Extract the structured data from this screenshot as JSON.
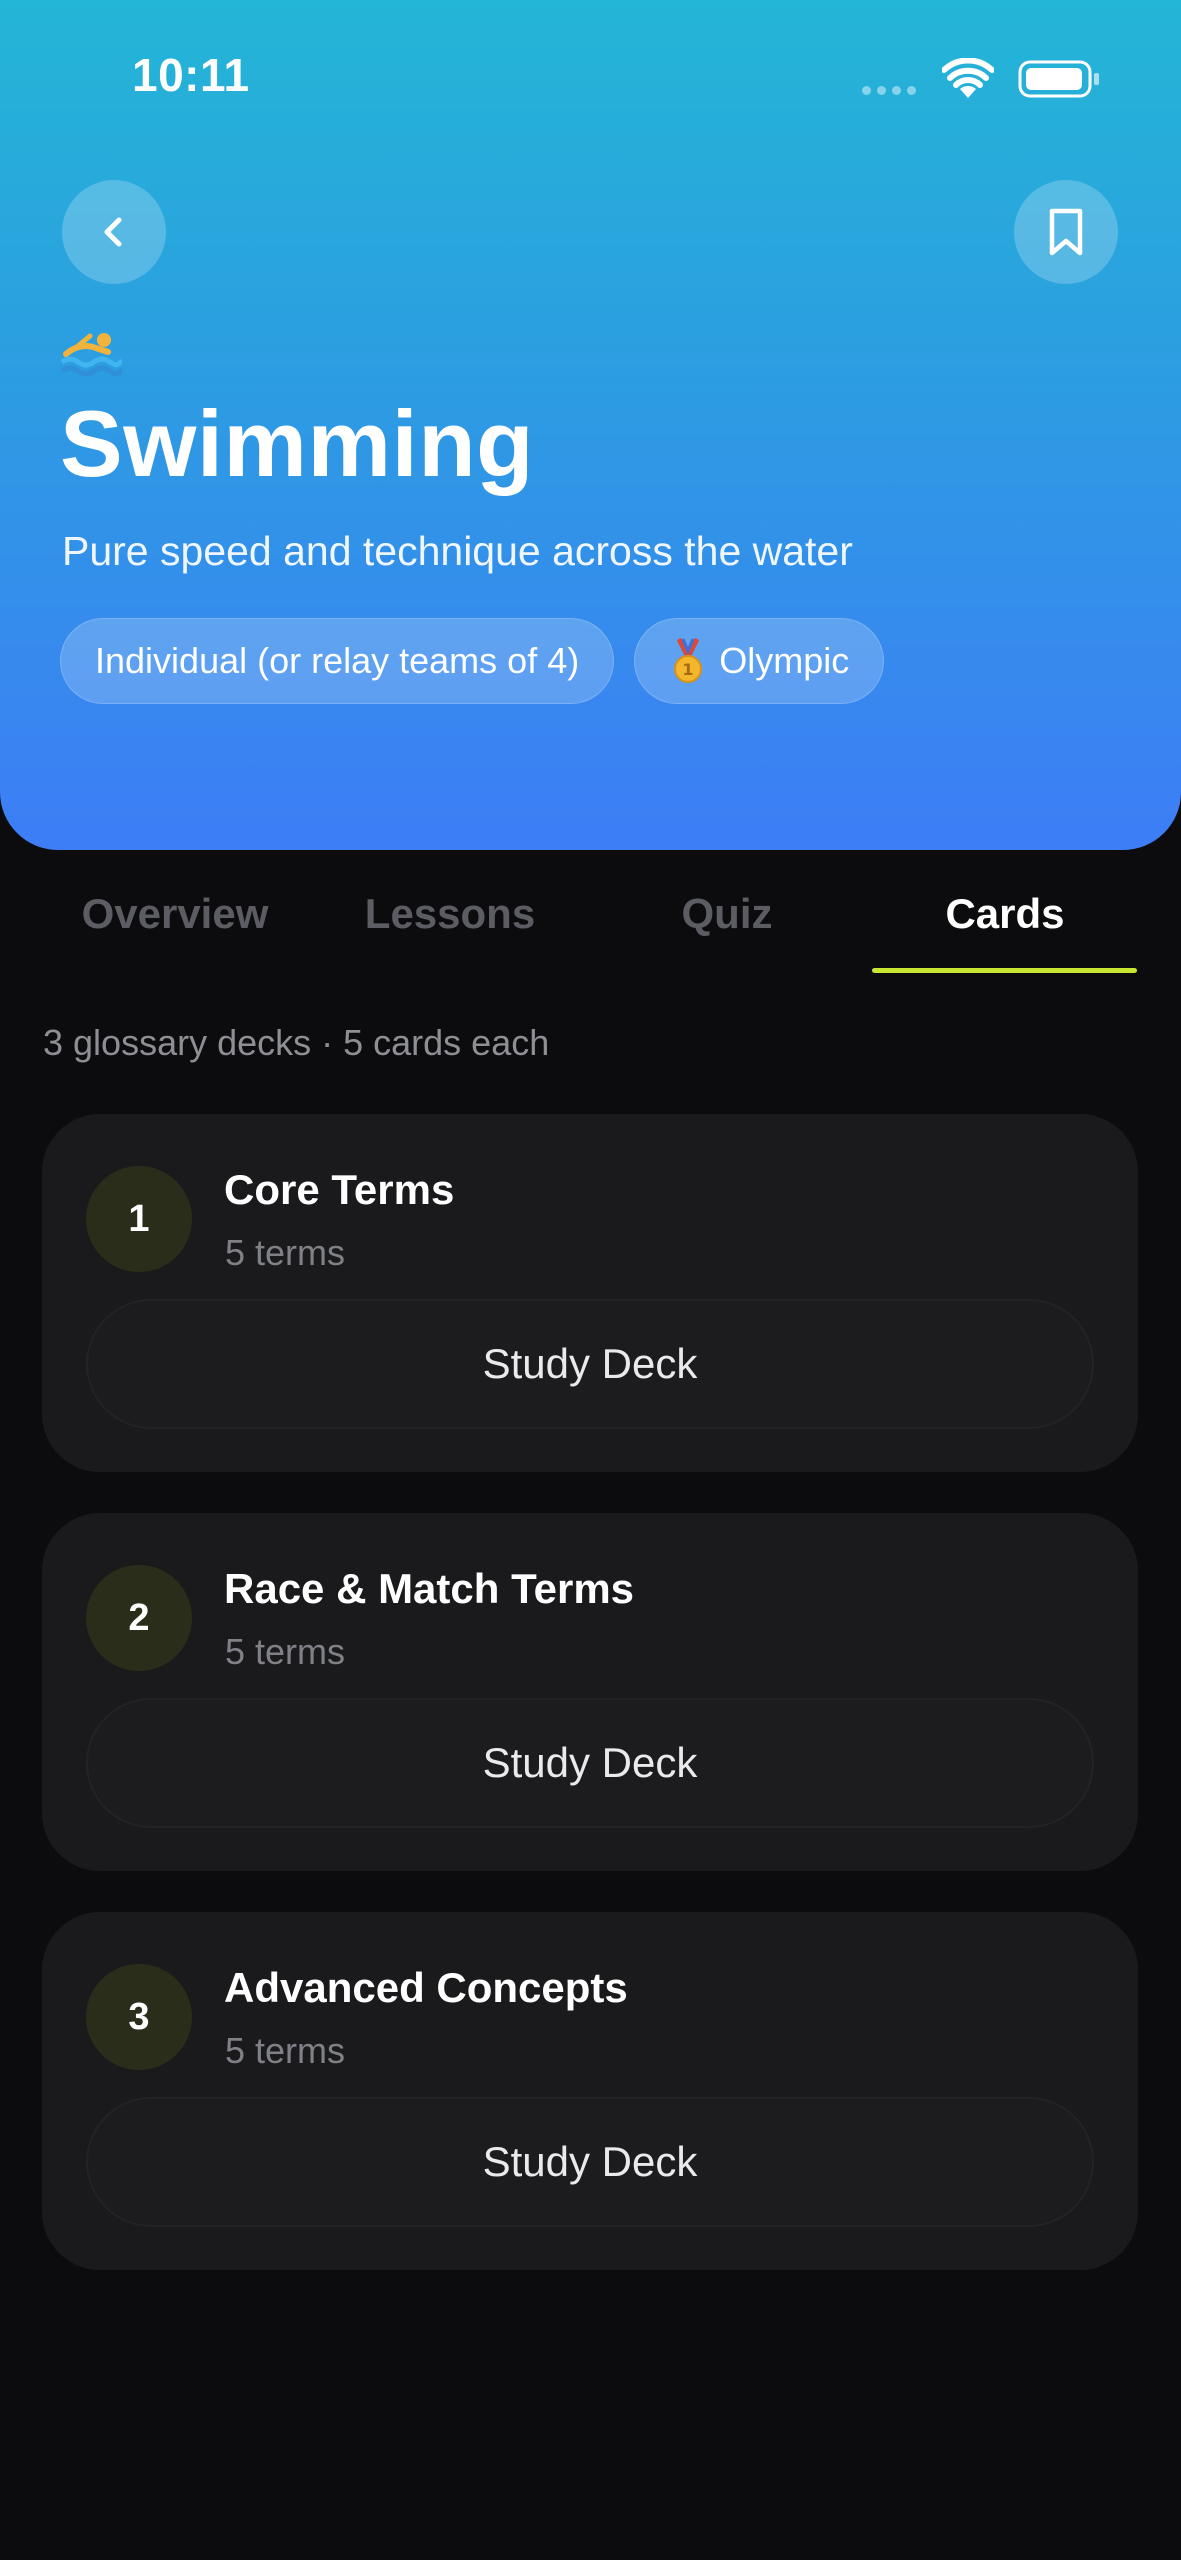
{
  "status_bar": {
    "time": "10:11"
  },
  "header": {
    "emoji_icon": "swimmer-icon",
    "title": "Swimming",
    "subtitle": "Pure speed and technique across the water",
    "chips": [
      {
        "label": "Individual (or relay teams of 4)"
      },
      {
        "label": "Olympic",
        "icon": "gold-medal-icon"
      }
    ],
    "back_icon": "chevron-left-icon",
    "bookmark_icon": "bookmark-icon"
  },
  "tabs": [
    {
      "label": "Overview",
      "active": false
    },
    {
      "label": "Lessons",
      "active": false
    },
    {
      "label": "Quiz",
      "active": false
    },
    {
      "label": "Cards",
      "active": true
    }
  ],
  "summary": "3 glossary decks · 5 cards each",
  "decks": [
    {
      "number": "1",
      "title": "Core Terms",
      "count": "5 terms",
      "button": "Study Deck"
    },
    {
      "number": "2",
      "title": "Race & Match Terms",
      "count": "5 terms",
      "button": "Study Deck"
    },
    {
      "number": "3",
      "title": "Advanced Concepts",
      "count": "5 terms",
      "button": "Study Deck"
    }
  ],
  "colors": {
    "background": "#0c0c0e",
    "hero_gradient_top": "#24b6d6",
    "hero_gradient_bottom": "#3d7df6",
    "accent": "#c8e632",
    "card": "#1a1a1c"
  }
}
